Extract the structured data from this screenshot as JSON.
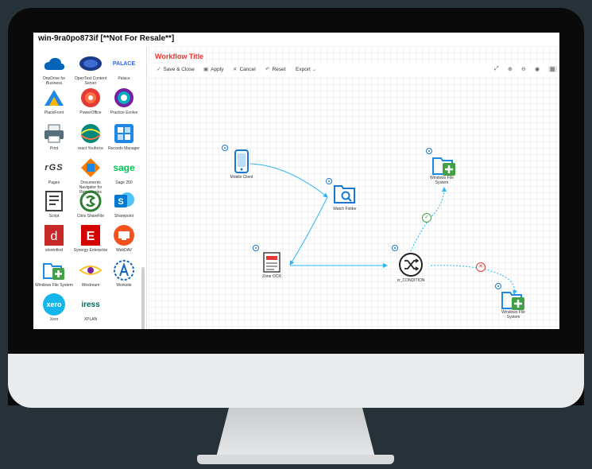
{
  "window": {
    "title": "win-9ra0po873if [**Not For Resale**]"
  },
  "sidebar": {
    "tiles": [
      {
        "label": "OneDrive for Business",
        "icon": "onedrive-icon",
        "color": "#0364b8"
      },
      {
        "label": "OpenText Content Server",
        "icon": "opentext-icon",
        "color": "#1a3a8a"
      },
      {
        "label": "Palace",
        "icon": "palace-icon",
        "color": "#2962ff"
      },
      {
        "label": "PlaceFront",
        "icon": "placefront-icon",
        "color": "#1e88e5"
      },
      {
        "label": "PowerOffice",
        "icon": "poweroffice-icon",
        "color": "#e53935"
      },
      {
        "label": "Practice Evolve",
        "icon": "practice-evolve-icon",
        "color": "#7b1fa2"
      },
      {
        "label": "Print",
        "icon": "printer-icon",
        "color": "#546e7a"
      },
      {
        "label": "react Youforce",
        "icon": "youforce-icon",
        "color": "#00897b"
      },
      {
        "label": "Records Manager",
        "icon": "records-manager-icon",
        "color": "#1e88e5"
      },
      {
        "label": "Pages",
        "icon": "rgs-icon",
        "color": "#333333"
      },
      {
        "label": "Documents Navigator for Repositories",
        "icon": "documents-navigator-icon",
        "color": "#f57c00"
      },
      {
        "label": "Sage 200",
        "icon": "sage-icon",
        "color": "#00c853"
      },
      {
        "label": "Script",
        "icon": "script-icon",
        "color": "#424242"
      },
      {
        "label": "Citrix ShareFile",
        "icon": "sharefile-icon",
        "color": "#2e7d32"
      },
      {
        "label": "Sharepoint",
        "icon": "sharepoint-icon",
        "color": "#0078d4"
      },
      {
        "label": "storenfind",
        "icon": "storenfind-icon",
        "color": "#c62828"
      },
      {
        "label": "Synergy Enterprise",
        "icon": "synergy-icon",
        "color": "#d50000"
      },
      {
        "label": "WebDAV",
        "icon": "webdav-icon",
        "color": "#f4511e"
      },
      {
        "label": "Windows File System",
        "icon": "windows-file-system-icon",
        "color": "#43a047"
      },
      {
        "label": "Windream",
        "icon": "windream-icon",
        "color": "#fbc02d"
      },
      {
        "label": "Worksite",
        "icon": "worksite-icon",
        "color": "#1565c0"
      },
      {
        "label": "Xero",
        "icon": "xero-icon",
        "color": "#13b5ea"
      },
      {
        "label": "XPLAN",
        "icon": "iress-icon",
        "color": "#00695c"
      }
    ],
    "logos": {
      "palace": "PALACE",
      "rgs": "rGS",
      "sage": "sage",
      "xero": "xero",
      "iress": "iress"
    }
  },
  "workflow": {
    "title": "Workflow Title",
    "toolbar": {
      "save": "Save & Close",
      "apply": "Apply",
      "cancel": "Cancel",
      "reset": "Reset",
      "export": "Export"
    },
    "nodes": {
      "mobile": "Mobile Client",
      "watch": "Watch Folder",
      "zone": "Zone OCR",
      "condition": "xr_CONDITION",
      "wfs1": "Windows File System",
      "wfs2": "Windows File System"
    }
  },
  "colors": {
    "accent": "#1976d2",
    "title": "#e53935",
    "connector": "#29b6f6",
    "success": "#43a047",
    "fail": "#e53935"
  }
}
